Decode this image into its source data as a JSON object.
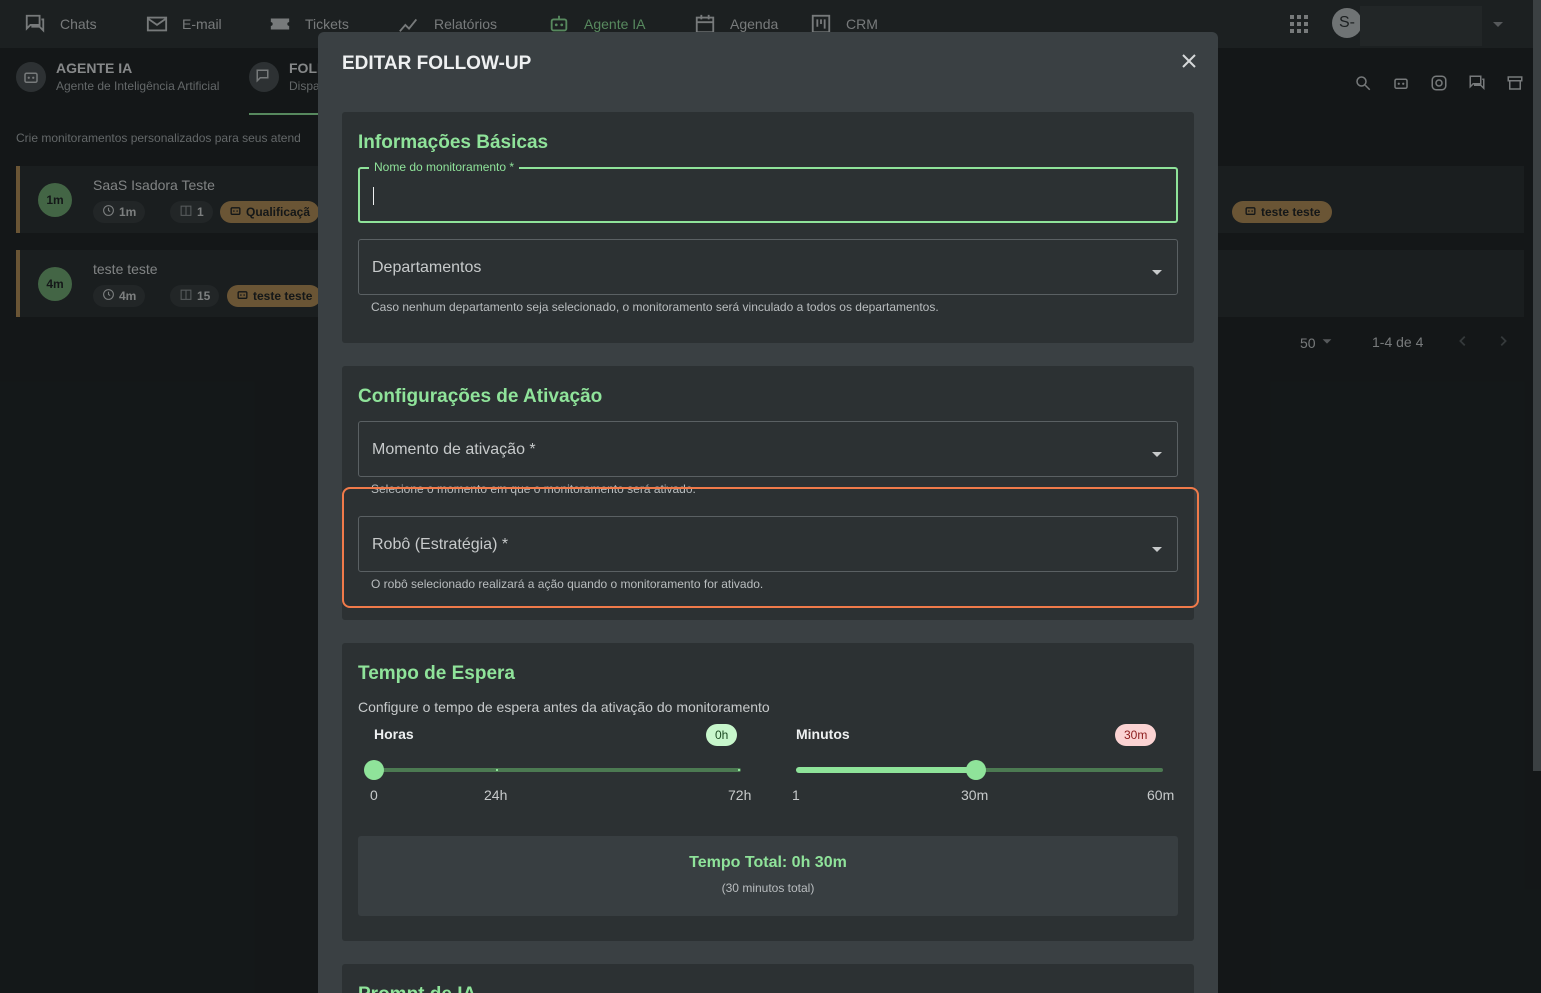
{
  "nav": {
    "items": [
      {
        "label": "Chats",
        "icon": "chat-icon"
      },
      {
        "label": "E-mail",
        "icon": "mail-icon"
      },
      {
        "label": "Tickets",
        "icon": "ticket-icon"
      },
      {
        "label": "Relatórios",
        "icon": "chart-icon"
      },
      {
        "label": "Agente IA",
        "icon": "robot-icon",
        "active": true
      },
      {
        "label": "Agenda",
        "icon": "calendar-icon"
      },
      {
        "label": "CRM",
        "icon": "kanban-icon"
      }
    ],
    "avatar_text": "S-",
    "accent": "#8fe39a"
  },
  "header": {
    "agent_title": "AGENTE IA",
    "agent_subtitle": "Agente de Inteligência Artificial",
    "follow_title": "FOLL",
    "follow_subtitle": "Dispa",
    "intro": "Crie monitoramentos personalizados para seus atend"
  },
  "list": {
    "rows": [
      {
        "avatar": "1m",
        "title": "SaaS Isadora Teste",
        "time": "1m",
        "depts": "1",
        "robot": "Qualificaçã"
      },
      {
        "avatar": "4m",
        "title": "teste teste",
        "time": "4m",
        "depts": "15",
        "robot": "teste teste"
      }
    ],
    "right_chip": "teste teste",
    "per_page": "50",
    "range": "1-4 de 4"
  },
  "modal": {
    "title": "EDITAR FOLLOW-UP",
    "basic": {
      "title": "Informações Básicas",
      "name_label": "Nome do monitoramento *",
      "dept_label": "Departamentos",
      "dept_helper": "Caso nenhum departamento seja selecionado, o monitoramento será vinculado a todos os departamentos."
    },
    "activation": {
      "title": "Configurações de Ativação",
      "moment_label": "Momento de ativação *",
      "moment_helper": "Selecione o momento em que o monitoramento será ativado.",
      "robot_label": "Robô (Estratégia) *",
      "robot_helper": "O robô selecionado realizará a ação quando o monitoramento for ativado."
    },
    "wait": {
      "title": "Tempo de Espera",
      "description": "Configure o tempo de espera antes da ativação do monitoramento",
      "hours_label": "Horas",
      "hours_badge": "0h",
      "hours_value": 0,
      "hours_max": 72,
      "hours_ticks": [
        "0",
        "24h",
        "72h"
      ],
      "minutes_label": "Minutos",
      "minutes_badge": "30m",
      "minutes_value": 30,
      "minutes_min": 1,
      "minutes_max": 60,
      "minutes_ticks": [
        "1",
        "30m",
        "60m"
      ],
      "total": "Tempo Total: 0h 30m",
      "total_sub": "(30 minutos total)"
    },
    "prompt": {
      "title": "Prompt de IA"
    }
  },
  "colors": {
    "highlight": "#f07a4a",
    "gold": "#b08a53"
  }
}
